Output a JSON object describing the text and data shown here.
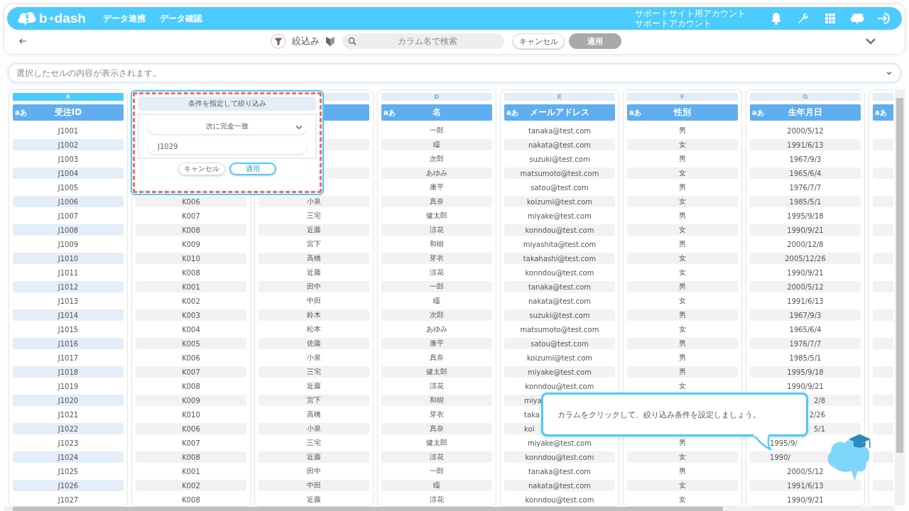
{
  "header": {
    "logo": {
      "left": "b",
      "right": "dash"
    },
    "nav": [
      {
        "label": "データ連携"
      },
      {
        "label": "データ確認"
      }
    ],
    "account": {
      "site": "サポートサイト用アカウント",
      "name": "サポートアカウント"
    }
  },
  "toolbar": {
    "filter_label": "絞込み",
    "search": {
      "placeholder": "カラム名で検索"
    },
    "cancel": "キャンセル",
    "apply": {
      "label": "適用",
      "disabled": true
    }
  },
  "cell_view": {
    "placeholder": "選択したセルの内容が表示されます。"
  },
  "columns": [
    {
      "kind": "full",
      "letter": "A",
      "type": "aあ",
      "header": "受注ID",
      "selected": true,
      "cells": [
        "J1001",
        "J1002",
        "J1003",
        "J1004",
        "J1005",
        "J1006",
        "J1007",
        "J1008",
        "J1009",
        "J1010",
        "J1011",
        "J1012",
        "J1013",
        "J1014",
        "J1015",
        "J1016",
        "J1017",
        "J1018",
        "J1019",
        "J1020",
        "J1021",
        "J1022",
        "J1023",
        "J1024",
        "J1025",
        "J1026",
        "J1027"
      ]
    },
    {
      "kind": "covered",
      "selected": false,
      "cells": [
        null,
        null,
        null,
        null,
        null,
        "K006",
        "K007",
        "K008",
        "K009",
        "K010",
        "K008",
        "K001",
        "K002",
        "K003",
        "K004",
        "K005",
        "K006",
        "K007",
        "K008",
        "K009",
        "K010",
        "K006",
        "K007",
        "K008",
        "K001",
        "K002",
        "K008"
      ]
    },
    {
      "kind": "full",
      "selected": false,
      "cells": [
        null,
        null,
        null,
        null,
        null,
        "小泉",
        "三宅",
        "近藤",
        "宮下",
        "高橋",
        "近藤",
        "田中",
        "中田",
        "鈴木",
        "松本",
        "佐藤",
        "小泉",
        "三宅",
        "近藤",
        "宮下",
        "高橋",
        "小泉",
        "三宅",
        "近藤",
        "田中",
        "中田",
        "近藤"
      ]
    },
    {
      "kind": "full",
      "letter": "D",
      "type": "aあ",
      "header": "名",
      "selected": false,
      "cells": [
        "一郎",
        "瞳",
        "次郎",
        "あゆみ",
        "康平",
        "真奈",
        "健太郎",
        "涼花",
        "和樹",
        "芽衣",
        "涼花",
        "一郎",
        "瞳",
        "次郎",
        "あゆみ",
        "康平",
        "真奈",
        "健太郎",
        "涼花",
        "和樹",
        "芽衣",
        "真奈",
        "健太郎",
        "涼花",
        "一郎",
        "瞳",
        "涼花"
      ]
    },
    {
      "kind": "full",
      "letter": "E",
      "type": "aあ",
      "header": "メールアドレス",
      "selected": false,
      "cells": [
        "tanaka@test.com",
        "nakata@test.com",
        "suzuki@test.com",
        "matsumoto@test.com",
        "satou@test.com",
        "koizumi@test.com",
        "miyake@test.com",
        "konndou@test.com",
        "miyashita@test.com",
        "takahashi@test.com",
        "konndou@test.com",
        "tanaka@test.com",
        "nakata@test.com",
        "suzuki@test.com",
        "matsumoto@test.com",
        "satou@test.com",
        "koizumi@test.com",
        "miyake@test.com",
        "konndou@test.com",
        {
          "text": "miya",
          "cut_right": true
        },
        {
          "text": "taka",
          "cut_right": true
        },
        {
          "text": "koi",
          "cut_right": true
        },
        "miyake@test.com",
        "konndou@test.com",
        "tanaka@test.com",
        "nakata@test.com",
        "konndou@test.com"
      ]
    },
    {
      "kind": "full",
      "letter": "F",
      "type": "aあ",
      "header": "性別",
      "selected": false,
      "cells": [
        "男",
        "女",
        "男",
        "女",
        "男",
        "女",
        "男",
        "女",
        "男",
        "女",
        "女",
        "男",
        "女",
        "男",
        "女",
        "男",
        "男",
        "男",
        "女",
        null,
        null,
        null,
        "男",
        "女",
        "男",
        "女",
        "女"
      ]
    },
    {
      "kind": "full",
      "letter": "G",
      "type": "aあ",
      "header": "生年月日",
      "selected": false,
      "cells": [
        "2000/5/12",
        "1991/6/13",
        "1967/9/3",
        "1965/6/4",
        "1976/7/7",
        "1985/5/1",
        "1995/9/18",
        "1990/9/21",
        "2000/12/8",
        "2005/12/26",
        "1990/9/21",
        "2000/5/12",
        "1991/6/13",
        "1967/9/3",
        "1965/6/4",
        "1976/7/7",
        "1985/5/1",
        "1995/9/18",
        "1990/9/21",
        {
          "text": "2/8",
          "cut_left": true
        },
        {
          "text": "2/26",
          "cut_left": true
        },
        {
          "text": "5/1",
          "cut_left": true
        },
        {
          "text": "1995/9/",
          "cut_right": true
        },
        {
          "text": "1990/",
          "cut_right": true
        },
        "2000/5/12",
        "1991/6/13",
        "1990/9/21"
      ]
    },
    {
      "kind": "cut",
      "type": "aあ",
      "selected": false
    }
  ],
  "filter_popup": {
    "title": "条件を指定して絞り込み",
    "operator": "次に完全一致",
    "value": "J1029",
    "cancel": "キャンセル",
    "apply": "適用"
  },
  "tip": {
    "text": "カラムをクリックして、絞り込み条件を設定しましょう。"
  }
}
